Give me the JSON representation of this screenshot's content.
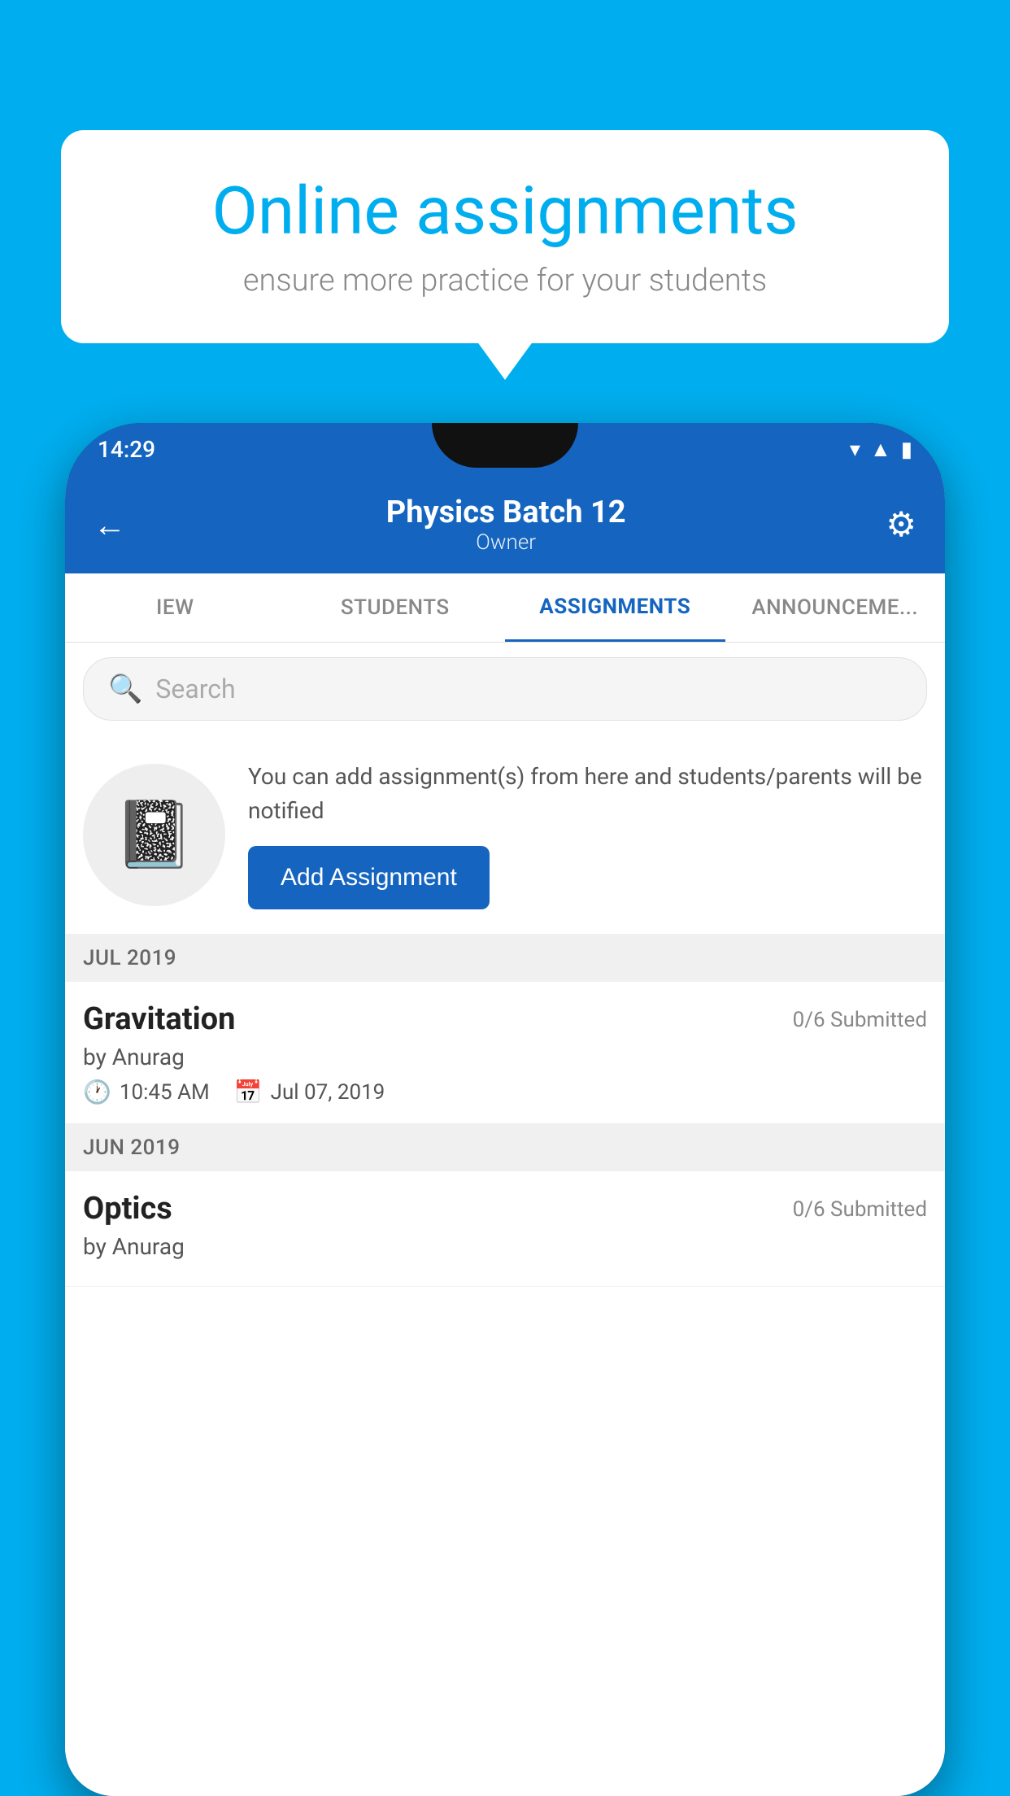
{
  "bubble": {
    "title": "Online assignments",
    "subtitle": "ensure more practice for your students"
  },
  "phone": {
    "statusBar": {
      "time": "14:29"
    },
    "header": {
      "title": "Physics Batch 12",
      "subtitle": "Owner",
      "backLabel": "←",
      "settingsLabel": "⚙"
    },
    "tabs": [
      {
        "label": "IEW",
        "active": false
      },
      {
        "label": "STUDENTS",
        "active": false
      },
      {
        "label": "ASSIGNMENTS",
        "active": true
      },
      {
        "label": "ANNOUNCEME...",
        "active": false
      }
    ],
    "search": {
      "placeholder": "Search"
    },
    "promo": {
      "text": "You can add assignment(s) from here and students/parents will be notified",
      "buttonLabel": "Add Assignment"
    },
    "sections": [
      {
        "monthLabel": "JUL 2019",
        "assignments": [
          {
            "name": "Gravitation",
            "submitted": "0/6 Submitted",
            "author": "by Anurag",
            "time": "10:45 AM",
            "date": "Jul 07, 2019"
          }
        ]
      },
      {
        "monthLabel": "JUN 2019",
        "assignments": [
          {
            "name": "Optics",
            "submitted": "0/6 Submitted",
            "author": "by Anurag",
            "time": "",
            "date": ""
          }
        ]
      }
    ]
  }
}
